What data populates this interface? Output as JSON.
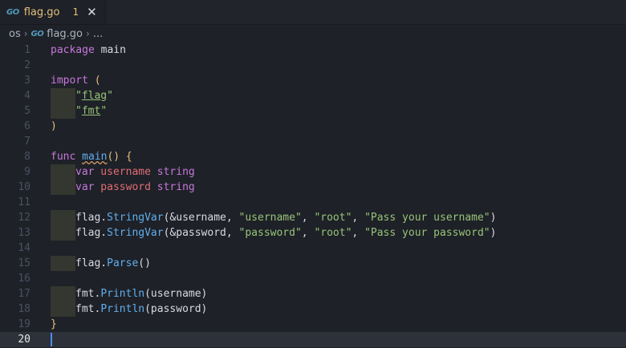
{
  "tab": {
    "icon": "go-file-icon",
    "icon_text": "GO",
    "title": "flag.go",
    "badge": "1",
    "close": "✕"
  },
  "breadcrumb": {
    "folder": "os",
    "sep": "›",
    "file_icon_text": "GO",
    "file": "flag.go",
    "more": "..."
  },
  "lines": {
    "n1": "1",
    "n2": "2",
    "n3": "3",
    "n4": "4",
    "n5": "5",
    "n6": "6",
    "n7": "7",
    "n8": "8",
    "n9": "9",
    "n10": "10",
    "n11": "11",
    "n12": "12",
    "n13": "13",
    "n14": "14",
    "n15": "15",
    "n16": "16",
    "n17": "17",
    "n18": "18",
    "n19": "19",
    "n20": "20"
  },
  "code": {
    "l1_kw": "package",
    "l1_name": " main",
    "l3_kw": "import",
    "l3_paren": " (",
    "l4_q1": "\"",
    "l4_str": "flag",
    "l4_q2": "\"",
    "l5_q1": "\"",
    "l5_str": "fmt",
    "l5_q2": "\"",
    "l6_paren": ")",
    "l8_kw": "func",
    "l8_fn": "main",
    "l8_rest": "() {",
    "l9_kw": "var",
    "l9_name": " username",
    "l9_type": " string",
    "l10_kw": "var",
    "l10_name": " password",
    "l10_type": " string",
    "l12_pkg": "flag.",
    "l12_fn": "StringVar",
    "l12_a": "(&username, ",
    "l12_s1": "\"username\"",
    "l12_c1": ", ",
    "l12_s2": "\"root\"",
    "l12_c2": ", ",
    "l12_s3": "\"Pass your username\"",
    "l12_end": ")",
    "l13_pkg": "flag.",
    "l13_fn": "StringVar",
    "l13_a": "(&password, ",
    "l13_s1": "\"password\"",
    "l13_c1": ", ",
    "l13_s2": "\"root\"",
    "l13_c2": ", ",
    "l13_s3": "\"Pass your password\"",
    "l13_end": ")",
    "l15_pkg": "flag.",
    "l15_fn": "Parse",
    "l15_end": "()",
    "l17_pkg": "fmt.",
    "l17_fn": "Println",
    "l17_end": "(username)",
    "l18_pkg": "fmt.",
    "l18_fn": "Println",
    "l18_end": "(password)",
    "l19_brace": "}"
  }
}
